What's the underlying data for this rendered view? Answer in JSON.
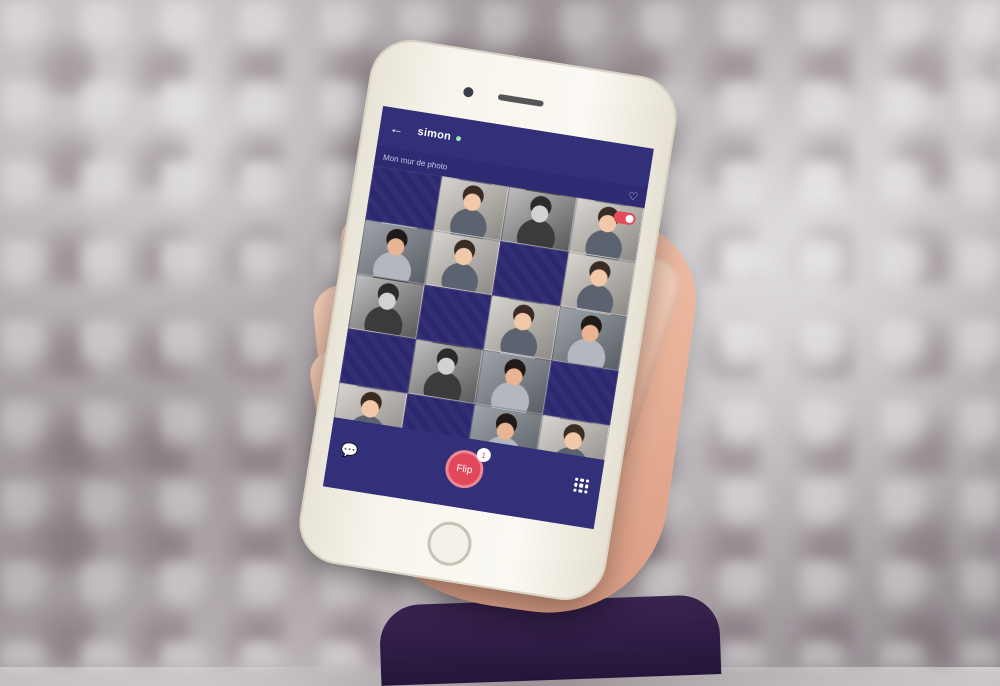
{
  "header": {
    "title": "simon",
    "subtitle": "Mon mur de photo"
  },
  "bottom": {
    "flip_label": "Flip",
    "flip_badge": "1"
  },
  "icons": {
    "back": "back-arrow-icon",
    "heart": "heart-icon",
    "chat": "chat-icon",
    "grid": "grid-icon"
  },
  "colors": {
    "primary_bg": "#2f2a6f",
    "accent": "#e2475b"
  },
  "grid": {
    "cells": [
      "empty",
      "photo",
      "bw",
      "photo",
      "photo",
      "photo",
      "empty",
      "photo",
      "bw",
      "empty",
      "photo",
      "photo",
      "empty",
      "photo",
      "photo",
      "empty",
      "photo",
      "empty",
      "photo",
      "photo"
    ]
  }
}
